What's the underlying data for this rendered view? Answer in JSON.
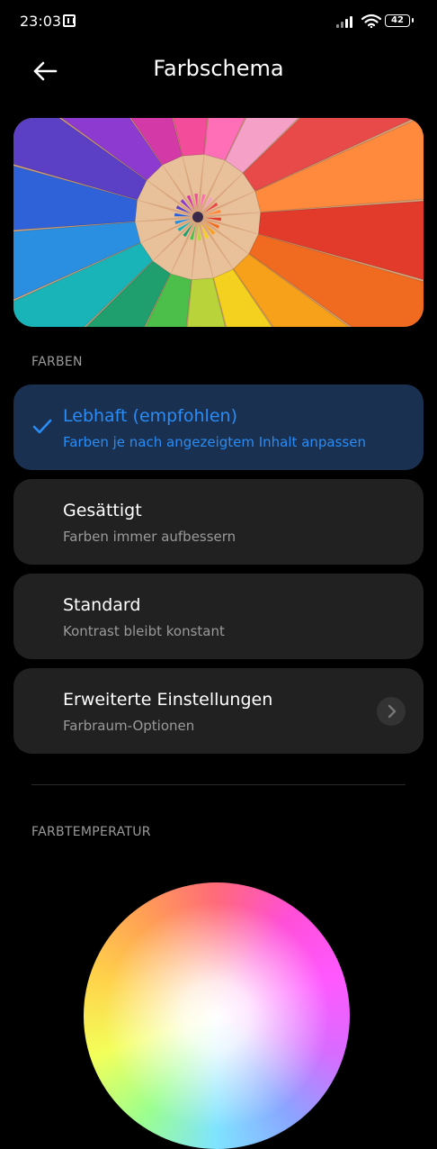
{
  "status_bar": {
    "time": "23:03",
    "battery": "42"
  },
  "header": {
    "title": "Farbschema"
  },
  "sections": {
    "colors_label": "FARBEN",
    "temperature_label": "FARBTEMPERATUR"
  },
  "options": [
    {
      "title": "Lebhaft (empfohlen)",
      "subtitle": "Farben je nach angezeigtem Inhalt anpassen",
      "selected": true
    },
    {
      "title": "Gesättigt",
      "subtitle": "Farben immer aufbessern",
      "selected": false
    },
    {
      "title": "Standard",
      "subtitle": "Kontrast bleibt konstant",
      "selected": false
    },
    {
      "title": "Erweiterte Einstellungen",
      "subtitle": "Farbraum-Optionen",
      "selected": false
    }
  ],
  "colors": {
    "accent": "#2a8cf4",
    "selected_card": "#193051",
    "card": "#212121",
    "background": "#000000"
  }
}
